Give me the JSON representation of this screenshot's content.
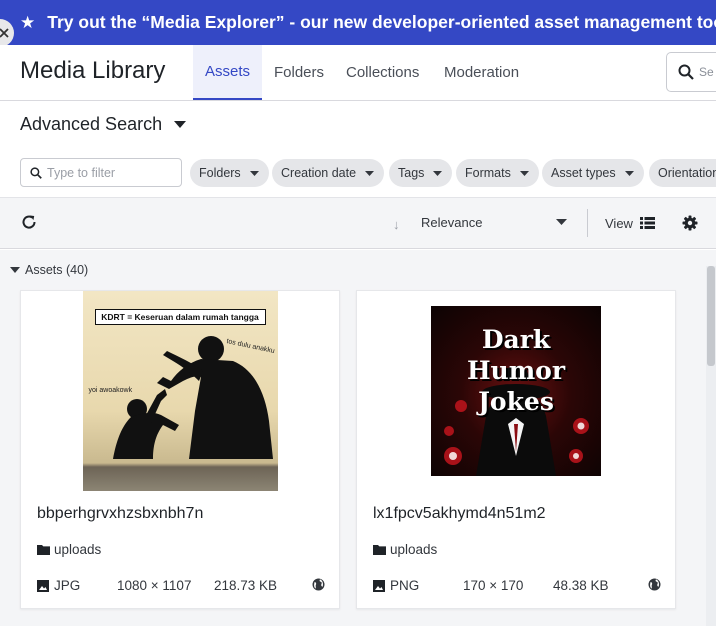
{
  "banner": {
    "icon": "star-icon",
    "text": "Try out the “Media Explorer” - our new developer-oriented asset management tool"
  },
  "header": {
    "app_title": "Media Library",
    "tabs": [
      {
        "label": "Assets",
        "active": true
      },
      {
        "label": "Folders",
        "active": false
      },
      {
        "label": "Collections",
        "active": false
      },
      {
        "label": "Moderation",
        "active": false
      }
    ],
    "search_placeholder": "Se"
  },
  "advanced_search": {
    "label": "Advanced Search"
  },
  "filters": {
    "input_placeholder": "Type to filter",
    "chips": [
      "Folders",
      "Creation date",
      "Tags",
      "Formats",
      "Asset types",
      "Orientation"
    ]
  },
  "toolbar": {
    "sort_label": "Relevance",
    "view_label": "View"
  },
  "assets": {
    "group_label": "Assets (40)",
    "items": [
      {
        "name": "bbperhgrvxhzsbxnbh7n",
        "folder": "uploads",
        "format": "JPG",
        "dimensions": "1080 × 1107",
        "size": "218.73 KB",
        "thumbnail": {
          "caption": "KDRT = Keseruan dalam rumah tangga",
          "text_right": "tos dulu anakku",
          "text_left": "yoi awoakowk"
        }
      },
      {
        "name": "lx1fpcv5akhymd4n51m2",
        "folder": "uploads",
        "format": "PNG",
        "dimensions": "170 × 170",
        "size": "48.38 KB",
        "thumbnail": {
          "title_line1": "Dark Humor",
          "title_line2": "Jokes"
        }
      }
    ]
  },
  "colors": {
    "accent": "#3448c5",
    "banner_bg": "#3448c5",
    "toolbar_bg": "#f4f5f7",
    "chip_bg": "#e5e6e9"
  }
}
